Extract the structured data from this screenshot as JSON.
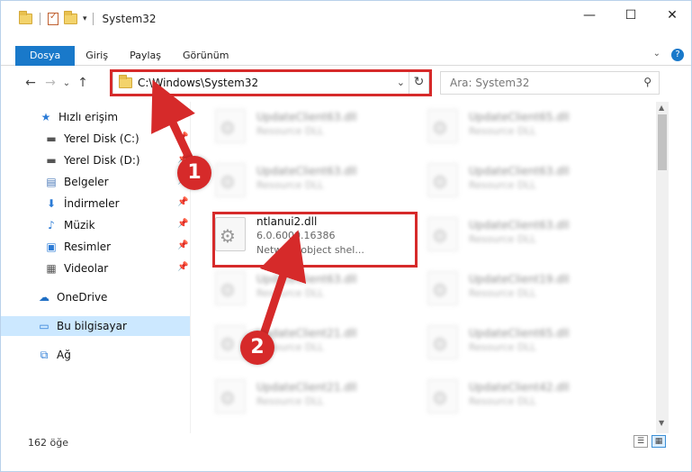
{
  "window": {
    "title": "System32",
    "controls": {
      "minimize": "—",
      "maximize": "☐",
      "close": "✕"
    }
  },
  "ribbon": {
    "tabs": [
      "Dosya",
      "Giriş",
      "Paylaş",
      "Görünüm"
    ],
    "expand": "⌄",
    "help": "?"
  },
  "address": {
    "path": "C:\\Windows\\System32",
    "search_placeholder": "Ara: System32"
  },
  "nav": {
    "quick_access": "Hızlı erişim",
    "items": [
      {
        "label": "Yerel Disk (C:)",
        "icon": "drive-icon"
      },
      {
        "label": "Yerel Disk (D:)",
        "icon": "drive-icon"
      },
      {
        "label": "Belgeler",
        "icon": "documents-icon"
      },
      {
        "label": "İndirmeler",
        "icon": "download-icon"
      },
      {
        "label": "Müzik",
        "icon": "music-icon"
      },
      {
        "label": "Resimler",
        "icon": "pictures-icon"
      },
      {
        "label": "Videolar",
        "icon": "video-icon"
      }
    ],
    "onedrive": "OneDrive",
    "this_pc": "Bu bilgisayar",
    "network": "Ağ"
  },
  "files": {
    "left": [
      {
        "name": "UpdateClient63.dll",
        "type": "Resource DLL"
      },
      {
        "name": "UpdateClient63.dll",
        "type": "Resource DLL"
      },
      {
        "name": "ntlanui2.dll",
        "version": "6.0.6000.16386",
        "description": "Network object shel..."
      },
      {
        "name": "UpdateClient63.dll",
        "type": "Resource DLL"
      },
      {
        "name": "UpdateClient21.dll",
        "type": "Resource DLL"
      },
      {
        "name": "UpdateClient21.dll",
        "type": "Resource DLL"
      }
    ],
    "right": [
      {
        "name": "UpdateClient65.dll",
        "type": "Resource DLL"
      },
      {
        "name": "UpdateClient63.dll",
        "type": "Resource DLL"
      },
      {
        "name": "UpdateClient63.dll",
        "type": "Resource DLL"
      },
      {
        "name": "UpdateClient19.dll",
        "type": "Resource DLL"
      },
      {
        "name": "UpdateClient65.dll",
        "type": "Resource DLL"
      },
      {
        "name": "UpdateClient42.dll",
        "type": "Resource DLL"
      }
    ]
  },
  "callouts": [
    "1",
    "2"
  ],
  "status": {
    "count": "162 öğe"
  },
  "colors": {
    "accent": "#1979ca",
    "callout": "#d62a2a",
    "selected": "#cce8ff"
  }
}
